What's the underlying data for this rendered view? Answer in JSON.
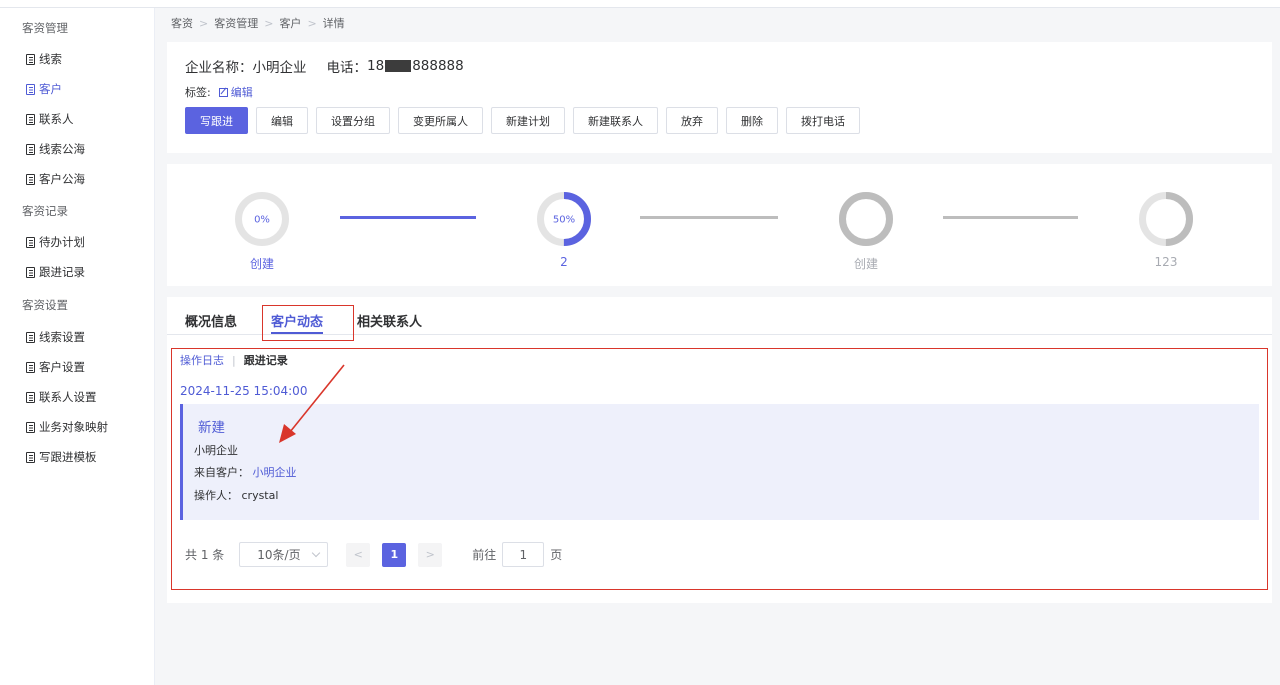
{
  "sidebar": {
    "groups": [
      {
        "label": "客资管理",
        "items": [
          {
            "label": "线索"
          },
          {
            "label": "客户",
            "active": true
          },
          {
            "label": "联系人"
          },
          {
            "label": "线索公海"
          },
          {
            "label": "客户公海"
          }
        ]
      },
      {
        "label": "客资记录",
        "items": [
          {
            "label": "待办计划"
          },
          {
            "label": "跟进记录"
          }
        ]
      },
      {
        "label": "客资设置",
        "items": [
          {
            "label": "线索设置"
          },
          {
            "label": "客户设置"
          },
          {
            "label": "联系人设置"
          },
          {
            "label": "业务对象映射"
          },
          {
            "label": "写跟进模板"
          }
        ]
      }
    ]
  },
  "breadcrumb": [
    "客资",
    "客资管理",
    "客户",
    "详情"
  ],
  "company": {
    "name_label": "企业名称：",
    "name": "小明企业",
    "phone_label": "电话：",
    "phone_prefix": "18",
    "phone_suffix": "888888"
  },
  "tags": {
    "label": "标签:",
    "edit": "编辑"
  },
  "actions": [
    "写跟进",
    "编辑",
    "设置分组",
    "变更所属人",
    "新建计划",
    "新建联系人",
    "放弃",
    "删除",
    "拨打电话"
  ],
  "steps": [
    {
      "percent": 0,
      "text": "0%",
      "label": "创建",
      "state": "active"
    },
    {
      "percent": 50,
      "text": "50%",
      "label": "2",
      "state": "active"
    },
    {
      "percent": 100,
      "text": "100%",
      "label": "创建",
      "state": "inactive"
    },
    {
      "percent": 50,
      "text": "50%",
      "label": "123",
      "state": "inactive"
    }
  ],
  "tabs": [
    {
      "label": "概况信息"
    },
    {
      "label": "客户动态",
      "active": true
    },
    {
      "label": "相关联系人"
    }
  ],
  "subtabs": [
    {
      "label": "操作日志",
      "active": true
    },
    {
      "label": "跟进记录"
    }
  ],
  "activity": {
    "timestamp": "2024-11-25 15:04:00",
    "title": "新建",
    "company": "小明企业",
    "from_label": "来自客户：",
    "from_value": "小明企业",
    "operator_label": "操作人：",
    "operator": "crystal"
  },
  "pagination": {
    "total_text": "共 1 条",
    "page_size": "10条/页",
    "current_page": "1",
    "goto_label": "前往",
    "goto_value": "1",
    "page_unit": "页"
  },
  "colors": {
    "accent": "#5b63e0",
    "highlight": "#d9362b",
    "inactive": "#bdbdbd",
    "track": "#e4e4e4"
  }
}
